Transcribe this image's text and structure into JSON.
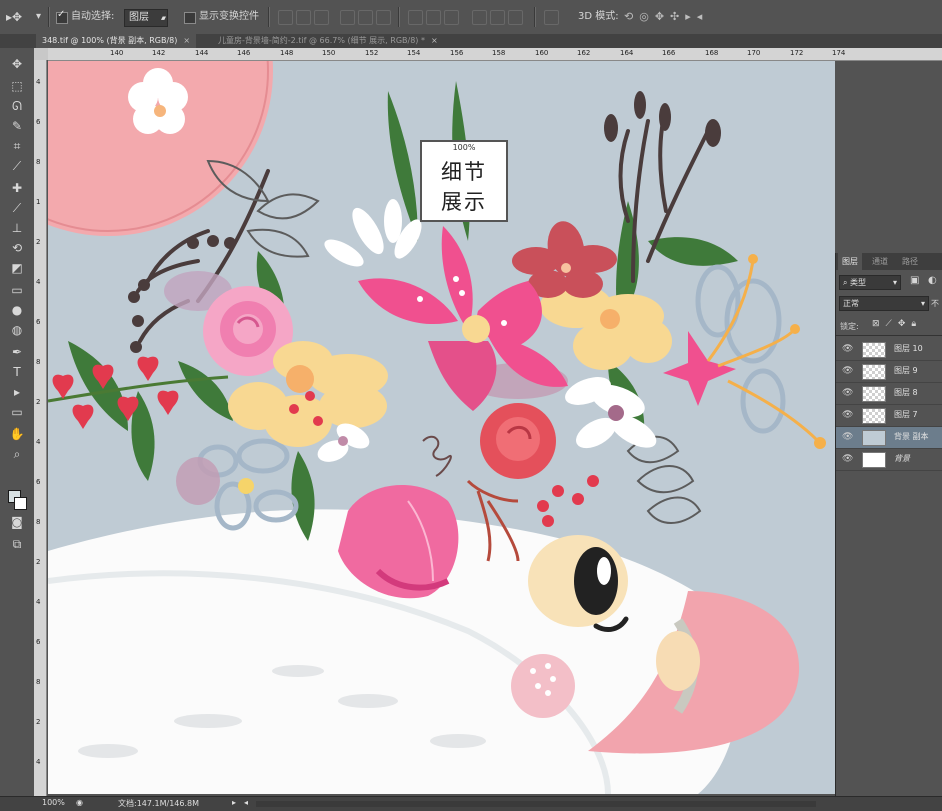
{
  "options_bar": {
    "auto_select_label": "自动选择:",
    "auto_select_value": "图层",
    "show_transform_label": "显示变换控件",
    "mode_3d_label": "3D 模式:"
  },
  "doc_tabs": [
    {
      "label": "348.tif @ 100% (背景 副本, RGB/8)",
      "close": "×"
    },
    {
      "label": "儿童房-背景墙-简约-2.tif @ 66.7% (细节 展示, RGB/8) *",
      "close": "×"
    }
  ],
  "ruler_top_ticks": [
    "140",
    "142",
    "144",
    "146",
    "148",
    "150",
    "152",
    "154",
    "156",
    "158",
    "160",
    "162",
    "164",
    "166",
    "168",
    "170",
    "172",
    "174"
  ],
  "ruler_left_ticks": [
    "4",
    "6",
    "8",
    "1",
    "2",
    "4",
    "6",
    "8",
    "2",
    "4",
    "6",
    "8",
    "2",
    "4",
    "6",
    "8",
    "2",
    "4"
  ],
  "overlay_label": {
    "percent": "100%",
    "line1": "细节",
    "line2": "展示"
  },
  "layers_panel": {
    "tabs": [
      "图层",
      "通道",
      "路径"
    ],
    "filter_type": "类型",
    "blend_mode": "正常",
    "opacity_prefix": "不",
    "lock_label": "锁定:",
    "layers": [
      {
        "name": "图层 10",
        "thumb": "transparent",
        "selected": false
      },
      {
        "name": "图层 9",
        "thumb": "transparent",
        "selected": false
      },
      {
        "name": "图层 8",
        "thumb": "transparent",
        "selected": false
      },
      {
        "name": "图层 7",
        "thumb": "transparent",
        "selected": false
      },
      {
        "name": "背景 副本",
        "thumb": "blue",
        "selected": true
      },
      {
        "name": "背景",
        "thumb": "white",
        "selected": false
      }
    ]
  },
  "status_bar": {
    "zoom": "100%",
    "doc_info": "文档:147.1M/146.8M"
  },
  "colors": {
    "canvas_bg": "#bfcbd4",
    "panel_bg": "#535353",
    "selected_layer": "#6c7d8c",
    "pink": "#f07a9a",
    "magenta": "#f0508f",
    "yellow": "#f8d892",
    "leaf_green": "#3f7a3a"
  }
}
